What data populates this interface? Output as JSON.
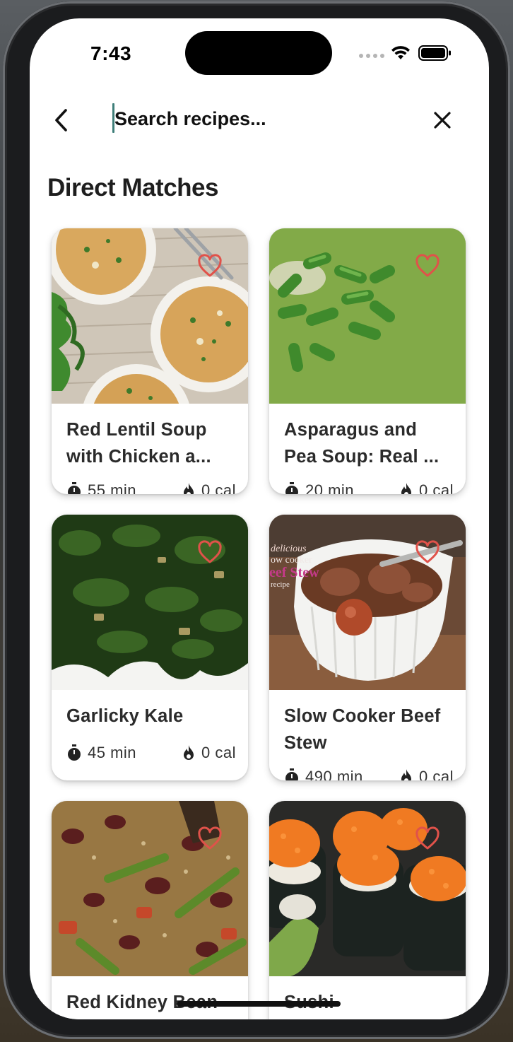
{
  "status_bar": {
    "time": "7:43"
  },
  "search": {
    "placeholder": "Search recipes..."
  },
  "section": {
    "title": "Direct Matches"
  },
  "colors": {
    "heart": "#e0524a",
    "caret": "#3f7f7a"
  },
  "recipes": [
    {
      "title": "Red Lentil Soup with Chicken a...",
      "time": "55 min",
      "calories": "0 cal"
    },
    {
      "title": "Asparagus and Pea Soup: Real ...",
      "time": "20 min",
      "calories": "0 cal"
    },
    {
      "title": "Garlicky Kale",
      "time": "45 min",
      "calories": "0 cal"
    },
    {
      "title": "Slow Cooker Beef Stew",
      "time": "490 min",
      "calories": "0 cal"
    },
    {
      "title": "Red Kidney Bean",
      "time": "",
      "calories": ""
    },
    {
      "title": "Sushi",
      "time": "",
      "calories": ""
    }
  ],
  "icons": {
    "back": "chevron-left-icon",
    "close": "close-icon",
    "favorite": "heart-outline-icon",
    "time": "timer-icon",
    "calories": "flame-icon"
  }
}
